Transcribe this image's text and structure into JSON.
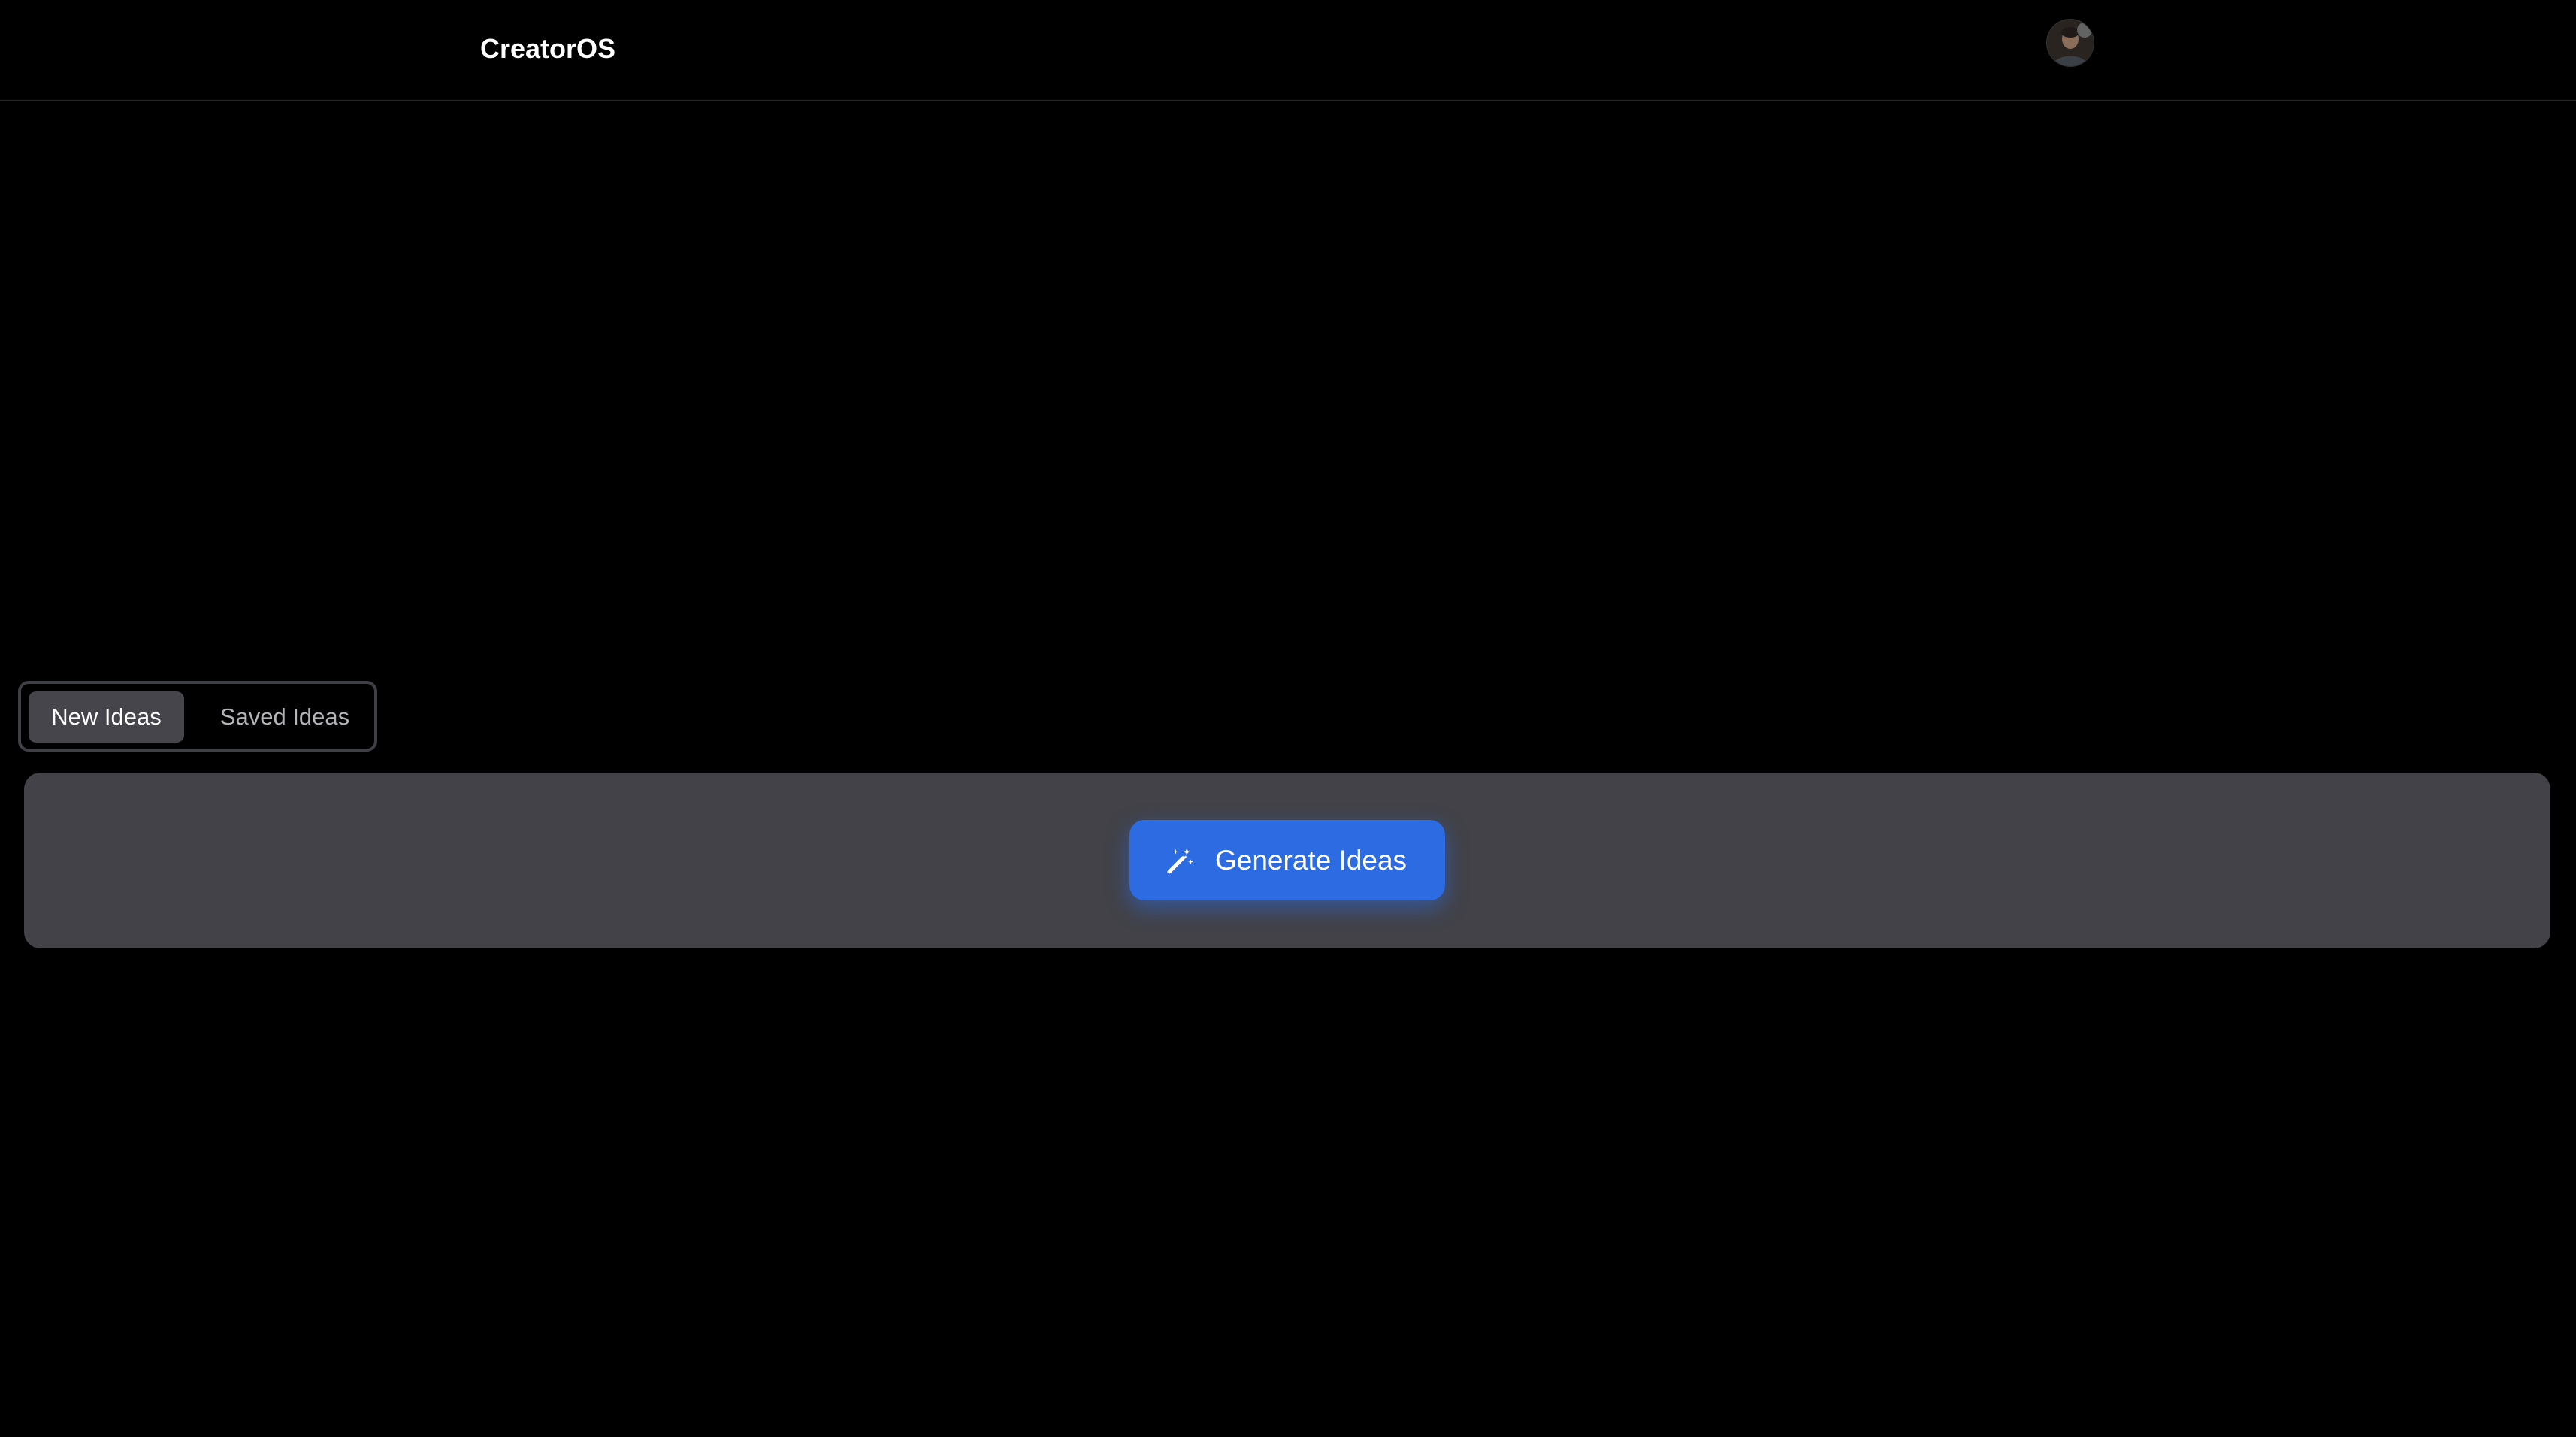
{
  "header": {
    "brand": "CreatorOS",
    "avatar_icon": "user-avatar-icon"
  },
  "tabs": [
    {
      "label": "New Ideas",
      "active": true
    },
    {
      "label": "Saved Ideas",
      "active": false
    }
  ],
  "main": {
    "generate_button_label": "Generate Ideas",
    "generate_button_icon": "magic-wand-icon"
  },
  "colors": {
    "background": "#000000",
    "panel": "#424248",
    "accent": "#2c6be2",
    "active_tab": "#45454b"
  }
}
